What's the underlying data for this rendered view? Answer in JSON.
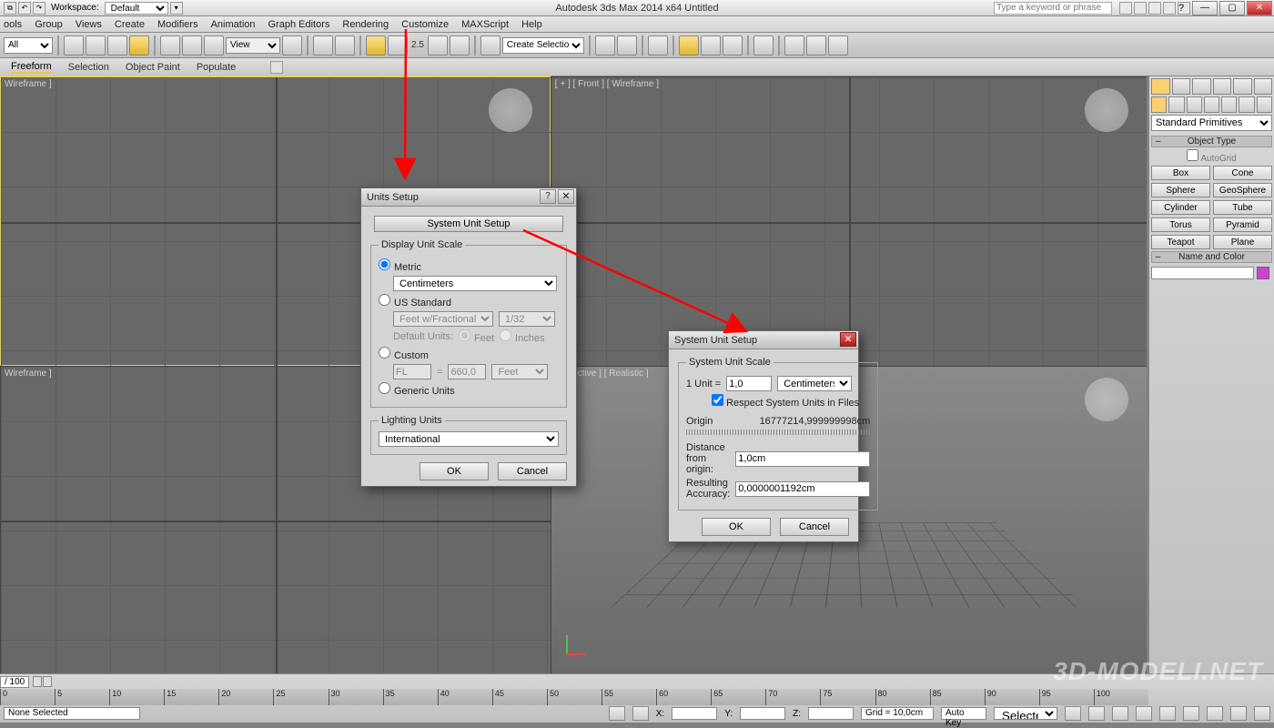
{
  "titlebar": {
    "workspace_label": "Workspace:",
    "workspace_value": "Default",
    "app_title": "Autodesk 3ds Max 2014 x64   Untitled",
    "search_placeholder": "Type a keyword or phrase"
  },
  "menus": [
    "ools",
    "Group",
    "Views",
    "Create",
    "Modifiers",
    "Animation",
    "Graph Editors",
    "Rendering",
    "Customize",
    "MAXScript",
    "Help"
  ],
  "toolbar": {
    "filter_value": "All",
    "view_label": "View",
    "spinner_value": "2.5",
    "selset_placeholder": "Create Selection Se"
  },
  "ribbon_tabs": [
    "Freeform",
    "Selection",
    "Object Paint",
    "Populate"
  ],
  "viewports": {
    "top_left_label": "Wireframe ]",
    "top_right_label": "[ + ] [ Front ] [ Wireframe ]",
    "bottom_left_label": "Wireframe ]",
    "bottom_right_label": "erspective ] [ Realistic ]"
  },
  "cmdpanel": {
    "dropdown_value": "Standard Primitives",
    "object_type_title": "Object Type",
    "autogrid_label": "AutoGrid",
    "buttons": [
      "Box",
      "Cone",
      "Sphere",
      "GeoSphere",
      "Cylinder",
      "Tube",
      "Torus",
      "Pyramid",
      "Teapot",
      "Plane"
    ],
    "name_color_title": "Name and Color"
  },
  "dialog1": {
    "title": "Units Setup",
    "system_btn": "System Unit Setup",
    "display_scale_legend": "Display Unit Scale",
    "opt_metric": "Metric",
    "metric_value": "Centimeters",
    "opt_us": "US Standard",
    "us_value": "Feet w/Fractional Inches",
    "us_frac": "1/32",
    "default_units_label": "Default Units:",
    "default_feet": "Feet",
    "default_inches": "Inches",
    "opt_custom": "Custom",
    "custom_abbr": "FL",
    "custom_eq": "=",
    "custom_val": "660,0",
    "custom_unit": "Feet",
    "opt_generic": "Generic Units",
    "lighting_legend": "Lighting Units",
    "lighting_value": "International",
    "ok": "OK",
    "cancel": "Cancel"
  },
  "dialog2": {
    "title": "System Unit Setup",
    "scale_legend": "System Unit Scale",
    "one_unit_label": "1 Unit =",
    "one_unit_value": "1,0",
    "one_unit_select": "Centimeters",
    "respect_label": "Respect System Units in Files",
    "origin_label": "Origin",
    "origin_value": "16777214,999999998cm",
    "distance_label": "Distance from origin:",
    "distance_value": "1,0cm",
    "accuracy_label": "Resulting Accuracy:",
    "accuracy_value": "0,0000001192cm",
    "ok": "OK",
    "cancel": "Cancel"
  },
  "timeslider": {
    "frame_label": "/ 100"
  },
  "ruler_ticks": [
    "0",
    "5",
    "10",
    "15",
    "20",
    "25",
    "30",
    "35",
    "40",
    "45",
    "50",
    "55",
    "60",
    "65",
    "70",
    "75",
    "80",
    "85",
    "90",
    "95",
    "100"
  ],
  "status": {
    "selection": "None Selected",
    "x_label": "X:",
    "y_label": "Y:",
    "z_label": "Z:",
    "grid_label": "Grid = 10,0cm",
    "autokey": "Auto Key",
    "selected": "Selected"
  },
  "watermark": "3D-MODELI.NET"
}
